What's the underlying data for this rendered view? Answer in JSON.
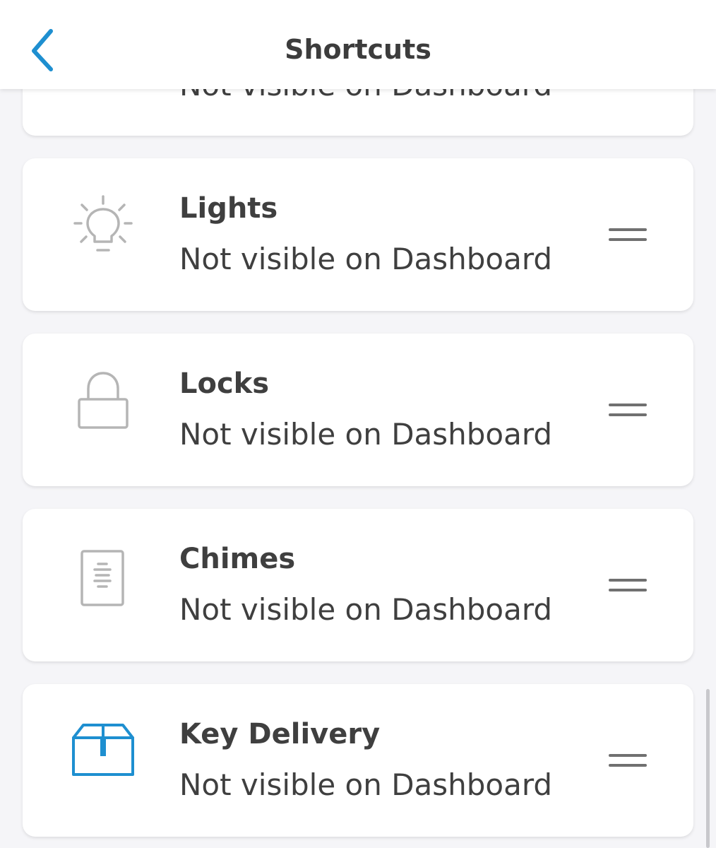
{
  "header": {
    "title": "Shortcuts",
    "back_icon": "chevron-left-icon"
  },
  "colors": {
    "accent": "#1e8fd0",
    "icon_gray": "#b5b5b5",
    "text": "#3f3f3f",
    "background": "#f5f5f8",
    "card": "#ffffff"
  },
  "shortcuts": [
    {
      "title": "",
      "status": "Not visible on Dashboard",
      "icon": "partial-item"
    },
    {
      "title": "Lights",
      "status": "Not visible on Dashboard",
      "icon": "lightbulb-icon"
    },
    {
      "title": "Locks",
      "status": "Not visible on Dashboard",
      "icon": "lock-icon"
    },
    {
      "title": "Chimes",
      "status": "Not visible on Dashboard",
      "icon": "chime-icon"
    },
    {
      "title": "Key Delivery",
      "status": "Not visible on Dashboard",
      "icon": "package-icon"
    }
  ]
}
